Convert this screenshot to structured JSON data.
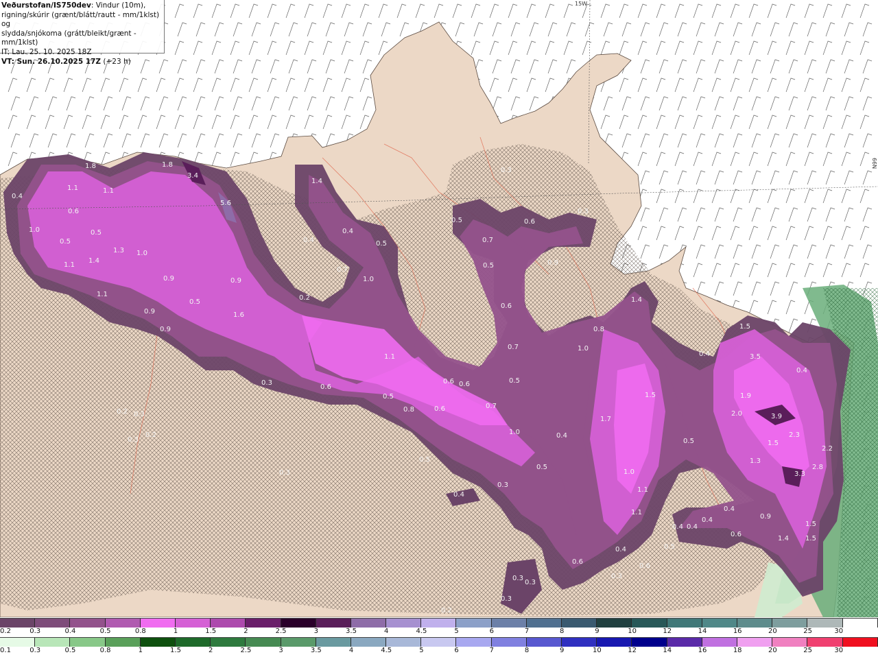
{
  "header": {
    "source": "Veðurstofan/IS750dev",
    "desc_line1": ": Vindur (10m),",
    "desc_line2": "rigning/skúrir (grænt/blátt/rautt - mm/1klst) og",
    "desc_line3": "slydda/snjókoma (grátt/bleikt/grænt - mm/1klst)",
    "init_time": "IT: Lau. 25. 10. 2025 18Z",
    "valid_time": "VT: Sun. 26.10.2025 17Z",
    "lead": "(+23 h)"
  },
  "grid_labels": {
    "top": "15W",
    "right": "66N"
  },
  "precip_labels": [
    "1.8",
    "1.8",
    "3.4",
    "0.4",
    "1.1",
    "1.1",
    "0.6",
    "5.6",
    "1.4",
    "1.0",
    "0.5",
    "0.5",
    "1.3",
    "1.0",
    "1.1",
    "1.4",
    "0.3",
    "0.5",
    "0.6",
    "0.3",
    "0.4",
    "0.4",
    "0.5",
    "0.7",
    "0.7",
    "0.9",
    "0.5",
    "1.0",
    "0.2",
    "1.6",
    "0.9",
    "0.9",
    "0.5",
    "1.1",
    "1.4",
    "0.6",
    "0.9",
    "0.8",
    "0.9",
    "1.1",
    "1.0",
    "0.7",
    "0.3",
    "0.6",
    "0.6",
    "0.6",
    "0.5",
    "0.5",
    "0.8",
    "0.6",
    "0.7",
    "1.0",
    "0.4",
    "1.5",
    "1.7",
    "0.4",
    "3.5",
    "1.5",
    "0.4",
    "1.9",
    "2.0",
    "3.9",
    "2.3",
    "0.5",
    "1.5",
    "2.2",
    "1.3",
    "2.8",
    "3.3",
    "0.2",
    "0.3",
    "0.3",
    "0.2",
    "0.5",
    "0.3",
    "0.4",
    "0.5",
    "0.3",
    "1.0",
    "1.1",
    "1.1",
    "0.4",
    "0.4",
    "0.4",
    "0.4",
    "0.9",
    "0.6",
    "1.5",
    "1.4",
    "1.5",
    "0.4",
    "0.5",
    "0.6",
    "0.6",
    "0.3",
    "0.3",
    "0.3",
    "0.3",
    "0.2"
  ],
  "legend_top": {
    "labels": [
      "0.2",
      "0.3",
      "0.4",
      "0.5",
      "0.8",
      "1",
      "1.5",
      "2",
      "2.5",
      "3",
      "3.5",
      "4",
      "4.5",
      "5",
      "6",
      "7",
      "8",
      "9",
      "10",
      "12",
      "14",
      "16",
      "20",
      "25",
      "30"
    ],
    "colors": [
      "#6b4468",
      "#7e4c7a",
      "#93528c",
      "#b05ab0",
      "#f06cf0",
      "#d560d5",
      "#ad4aad",
      "#6a1e6a",
      "#2a002a",
      "#5a1e5a",
      "#8e6ca8",
      "#a690d0",
      "#c0b0ec",
      "#8ca0c8",
      "#6c80a8",
      "#507090",
      "#3a5a70",
      "#204040",
      "#285858",
      "#407878",
      "#508888",
      "#5e8c8c",
      "#7e9e9e",
      "#aeb8b8",
      "#ffffff"
    ]
  },
  "legend_bottom": {
    "labels": [
      "0.1",
      "0.3",
      "0.5",
      "0.8",
      "1",
      "1.5",
      "2",
      "2.5",
      "3",
      "3.5",
      "4",
      "4.5",
      "5",
      "6",
      "7",
      "8",
      "9",
      "10",
      "12",
      "14",
      "16",
      "18",
      "20",
      "25",
      "30"
    ],
    "colors": [
      "#e6fae6",
      "#b8e6b8",
      "#88c888",
      "#5aa05a",
      "#0e500e",
      "#1e6a2a",
      "#2e7a3e",
      "#468a52",
      "#5a9a6a",
      "#6a9aa0",
      "#8aa8c0",
      "#a8b8d8",
      "#c8c8f0",
      "#a8a8f0",
      "#8080e0",
      "#5858d0",
      "#3030c0",
      "#1818b0",
      "#00008c",
      "#5a2aa8",
      "#c070e0",
      "#f0a0f0",
      "#f080c0",
      "#f04070",
      "#f01020"
    ]
  }
}
